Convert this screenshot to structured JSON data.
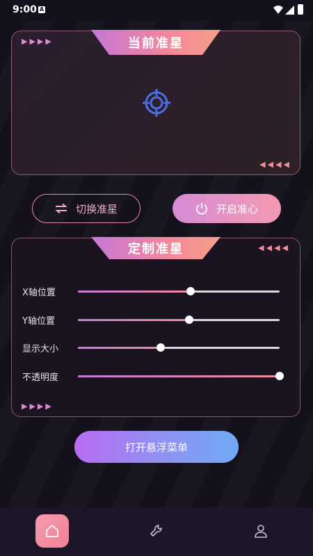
{
  "status_bar": {
    "time": "9:00",
    "notification_glyph": "A"
  },
  "crosshair_panel": {
    "title": "当前准星",
    "arrows_right": "▶▶▶▶",
    "arrows_left": "◀◀◀◀",
    "crosshair_icon": "crosshair-icon",
    "crosshair_color": "#4b6fe6"
  },
  "buttons": {
    "switch_label": "切换准星",
    "aim_label": "开启准心",
    "float_label": "打开悬浮菜单"
  },
  "custom_panel": {
    "title": "定制准星",
    "arrows_left": "◀◀◀◀",
    "arrows_right": "▶▶▶▶",
    "sliders": [
      {
        "label": "X轴位置",
        "value": 0.56
      },
      {
        "label": "Y轴位置",
        "value": 0.55
      },
      {
        "label": "显示大小",
        "value": 0.41
      },
      {
        "label": "不透明度",
        "value": 1.0
      }
    ]
  },
  "nav": {
    "items": [
      {
        "icon": "home-icon",
        "active": true
      },
      {
        "icon": "wrench-icon",
        "active": false
      },
      {
        "icon": "user-icon",
        "active": false
      }
    ]
  },
  "colors": {
    "accent_pink": "#f08a9e",
    "accent_purple": "#c578d8",
    "float_button_end": "#6fa9f4"
  }
}
